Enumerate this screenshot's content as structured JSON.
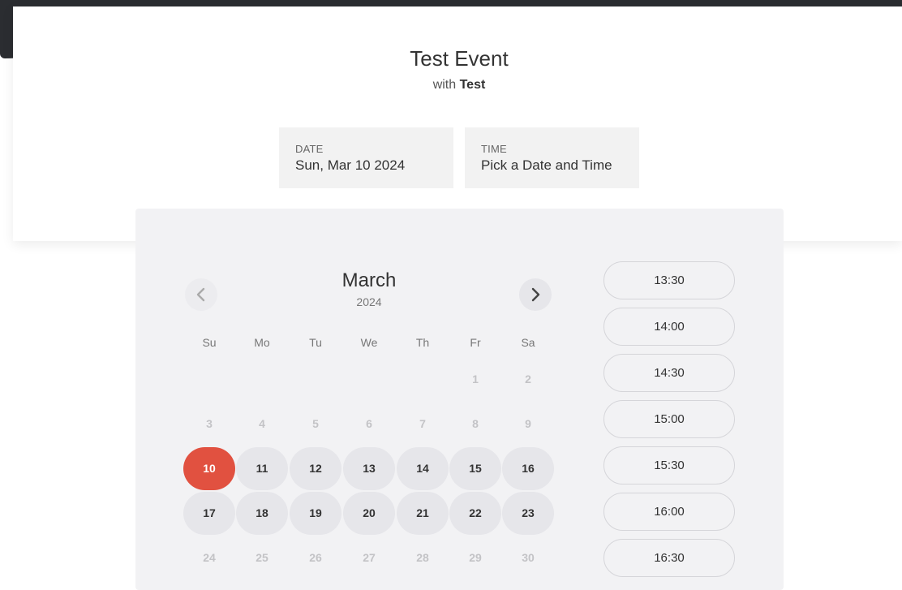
{
  "event": {
    "title": "Test Event",
    "with_prefix": "with",
    "with_name": "Test"
  },
  "fields": {
    "date": {
      "label": "DATE",
      "value": "Sun, Mar 10 2024"
    },
    "time": {
      "label": "TIME",
      "value": "Pick a Date and Time"
    }
  },
  "calendar": {
    "month": "March",
    "year": "2024",
    "weekdays": [
      "Su",
      "Mo",
      "Tu",
      "We",
      "Th",
      "Fr",
      "Sa"
    ],
    "selected_day": "10",
    "weeks": [
      [
        null,
        null,
        null,
        null,
        null,
        {
          "d": "1",
          "s": "muted"
        },
        {
          "d": "2",
          "s": "muted"
        }
      ],
      [
        {
          "d": "3",
          "s": "muted"
        },
        {
          "d": "4",
          "s": "muted"
        },
        {
          "d": "5",
          "s": "muted"
        },
        {
          "d": "6",
          "s": "muted"
        },
        {
          "d": "7",
          "s": "muted"
        },
        {
          "d": "8",
          "s": "muted"
        },
        {
          "d": "9",
          "s": "muted"
        }
      ],
      [
        {
          "d": "10",
          "s": "selected"
        },
        {
          "d": "11",
          "s": "avail"
        },
        {
          "d": "12",
          "s": "avail"
        },
        {
          "d": "13",
          "s": "avail"
        },
        {
          "d": "14",
          "s": "avail"
        },
        {
          "d": "15",
          "s": "avail"
        },
        {
          "d": "16",
          "s": "avail"
        }
      ],
      [
        {
          "d": "17",
          "s": "avail"
        },
        {
          "d": "18",
          "s": "avail"
        },
        {
          "d": "19",
          "s": "avail"
        },
        {
          "d": "20",
          "s": "avail"
        },
        {
          "d": "21",
          "s": "avail"
        },
        {
          "d": "22",
          "s": "avail"
        },
        {
          "d": "23",
          "s": "avail"
        }
      ],
      [
        {
          "d": "24",
          "s": "muted"
        },
        {
          "d": "25",
          "s": "muted"
        },
        {
          "d": "26",
          "s": "muted"
        },
        {
          "d": "27",
          "s": "muted"
        },
        {
          "d": "28",
          "s": "muted"
        },
        {
          "d": "29",
          "s": "muted"
        },
        {
          "d": "30",
          "s": "muted"
        }
      ]
    ],
    "prev_icon": "chevron-left-icon",
    "next_icon": "chevron-right-icon"
  },
  "time_slots": [
    "13:30",
    "14:00",
    "14:30",
    "15:00",
    "15:30",
    "16:00",
    "16:30"
  ],
  "colors": {
    "selected": "#e15140",
    "available": "#e6e6ea",
    "panel": "#f2f2f4"
  }
}
